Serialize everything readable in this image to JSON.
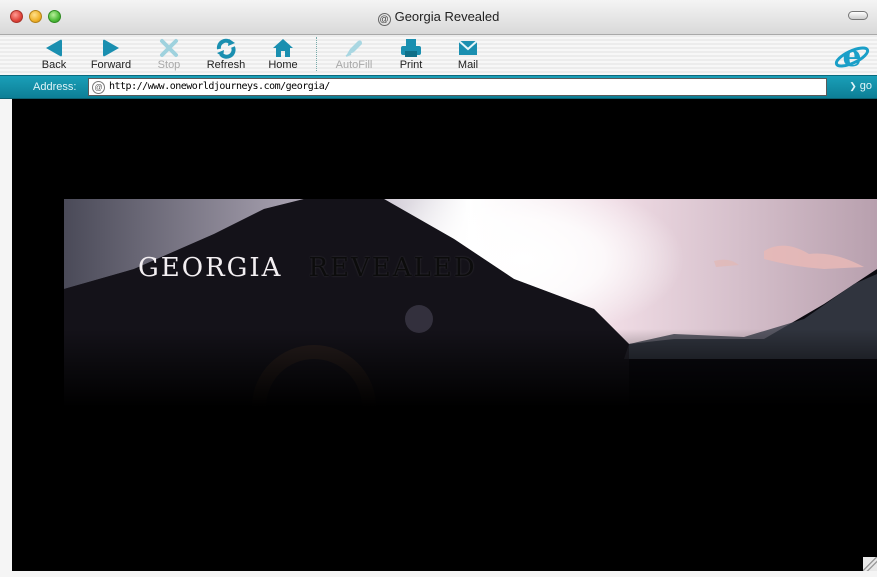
{
  "window": {
    "title": "Georgia Revealed"
  },
  "toolbar": {
    "buttons": [
      {
        "label": "Back",
        "icon": "back-arrow-icon",
        "enabled": true
      },
      {
        "label": "Forward",
        "icon": "forward-arrow-icon",
        "enabled": true
      },
      {
        "label": "Stop",
        "icon": "stop-x-icon",
        "enabled": false
      },
      {
        "label": "Refresh",
        "icon": "refresh-icon",
        "enabled": true
      },
      {
        "label": "Home",
        "icon": "home-icon",
        "enabled": true
      },
      {
        "label": "AutoFill",
        "icon": "autofill-icon",
        "enabled": false
      },
      {
        "label": "Print",
        "icon": "print-icon",
        "enabled": true
      },
      {
        "label": "Mail",
        "icon": "mail-icon",
        "enabled": true
      }
    ]
  },
  "address": {
    "label": "Address:",
    "url": "http://www.oneworldjourneys.com/georgia/",
    "go_label": "go"
  },
  "page": {
    "title_word1": "GEORGIA",
    "title_word2": "REVEALED"
  },
  "colors": {
    "toolbar_icon": "#1a8fb0",
    "address_bar": "#1593ab",
    "page_background": "#000000"
  }
}
